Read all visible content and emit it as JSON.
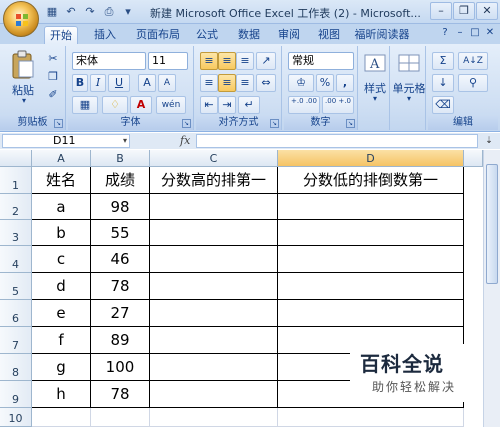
{
  "window": {
    "title": "新建 Microsoft Office Excel 工作表 (2) - Microsoft..."
  },
  "ribbon": {
    "tabs": [
      "开始",
      "插入",
      "页面布局",
      "公式",
      "数据",
      "审阅",
      "视图",
      "福昕阅读器"
    ],
    "active_tab": "开始",
    "clipboard": {
      "paste_label": "粘贴",
      "group_label": "剪贴板"
    },
    "font": {
      "name": "宋体",
      "size": "11",
      "bold": "B",
      "italic": "I",
      "underline": "U",
      "grow": "A",
      "shrink": "A",
      "color_a": "A",
      "phonetic": "wén",
      "group_label": "字体"
    },
    "alignment": {
      "group_label": "对齐方式"
    },
    "number": {
      "format": "常规",
      "percent": "%",
      "comma": ",",
      "inc_dec": "+.0 .00",
      "dec_dec": ".00 +.0",
      "group_label": "数字"
    },
    "styles": {
      "label": "样式"
    },
    "cells": {
      "label": "单元格"
    },
    "editing": {
      "sigma": "Σ",
      "sort": "A↓Z",
      "find": "♂",
      "group_label": "编辑"
    }
  },
  "formula_bar": {
    "name_box": "D11",
    "fx": "fx",
    "value": ""
  },
  "sheet": {
    "columns": [
      "A",
      "B",
      "C",
      "D"
    ],
    "active_column": "D",
    "rows": [
      "1",
      "2",
      "3",
      "4",
      "5",
      "6",
      "7",
      "8",
      "9",
      "10"
    ],
    "header_row": [
      "姓名",
      "成绩",
      "分数高的排第一",
      "分数低的排倒数第一"
    ],
    "data_rows": [
      [
        "a",
        "98"
      ],
      [
        "b",
        "55"
      ],
      [
        "c",
        "46"
      ],
      [
        "d",
        "78"
      ],
      [
        "e",
        "27"
      ],
      [
        "f",
        "89"
      ],
      [
        "g",
        "100"
      ],
      [
        "h",
        "78"
      ]
    ]
  },
  "watermark": {
    "title": "百科全说",
    "subtitle": "助你轻松解决"
  },
  "colors": {
    "ribbon_bg": "#cfdff3",
    "active_column": "#f5c365",
    "grid": "#d0d7e5"
  }
}
